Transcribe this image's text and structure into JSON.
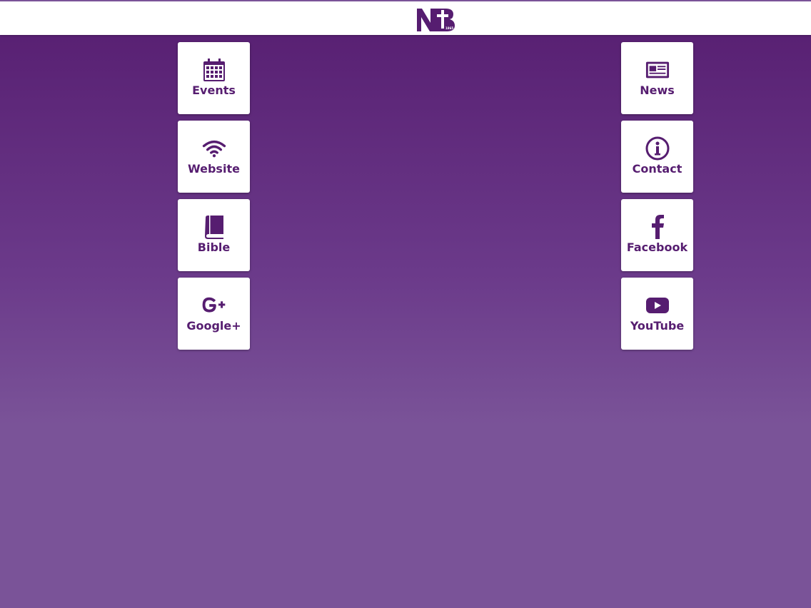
{
  "header": {
    "logo": {
      "text": "NB",
      "year": "1865",
      "icon": "nb-cross-logo"
    }
  },
  "colors": {
    "brand_purple": "#561d70",
    "background_top": "#561d70",
    "background_bottom": "#7a5398",
    "tile_background": "#ffffff"
  },
  "tiles": {
    "left": [
      {
        "label": "Events",
        "icon": "calendar-icon"
      },
      {
        "label": "Website",
        "icon": "wifi-icon"
      },
      {
        "label": "Bible",
        "icon": "book-icon"
      },
      {
        "label": "Google+",
        "icon": "google-plus-icon"
      }
    ],
    "right": [
      {
        "label": "News",
        "icon": "newspaper-icon"
      },
      {
        "label": "Contact",
        "icon": "info-icon"
      },
      {
        "label": "Facebook",
        "icon": "facebook-icon"
      },
      {
        "label": "YouTube",
        "icon": "youtube-icon"
      }
    ]
  }
}
